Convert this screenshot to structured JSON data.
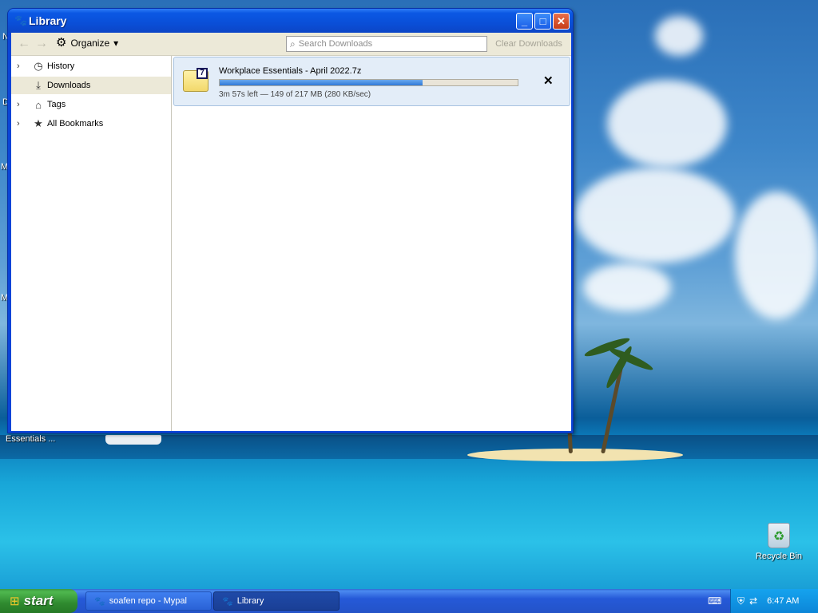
{
  "window": {
    "title": "Library",
    "buttons": {
      "minimize": "_",
      "maximize": "□",
      "close": "✕"
    }
  },
  "toolbar": {
    "back_icon": "back-arrow-icon",
    "forward_icon": "forward-arrow-icon",
    "organize_label": "Organize",
    "organize_dropdown": "▾",
    "search_placeholder": "Search Downloads",
    "clear_label": "Clear Downloads"
  },
  "sidebar": {
    "items": [
      {
        "label": "History",
        "icon": "clock-icon",
        "expandable": true
      },
      {
        "label": "Downloads",
        "icon": "download-icon",
        "expandable": false,
        "selected": true
      },
      {
        "label": "Tags",
        "icon": "tag-icon",
        "expandable": true
      },
      {
        "label": "All Bookmarks",
        "icon": "star-icon",
        "expandable": true
      }
    ]
  },
  "download": {
    "filename": "Workplace Essentials - April 2022.7z",
    "progress_fraction": 0.68,
    "status": "3m 57s left — 149 of 217 MB (280 KB/sec)",
    "badge": "7",
    "cancel": "✕"
  },
  "desktop": {
    "icon_labels": [
      "Essentials ...",
      "Recycle Bin"
    ],
    "partial_labels": [
      "N",
      "D",
      "M",
      "M"
    ]
  },
  "taskbar": {
    "start_label": "start",
    "tasks": [
      {
        "label": "soafen repo - Mypal",
        "active": false
      },
      {
        "label": "Library",
        "active": true
      }
    ],
    "clock": "6:47 AM"
  },
  "colors": {
    "titlebar": "#0a4fd8",
    "taskbar": "#2453c8",
    "start": "#2f8a2f",
    "progress": "#2f79d8",
    "close_button": "#c63d18"
  }
}
